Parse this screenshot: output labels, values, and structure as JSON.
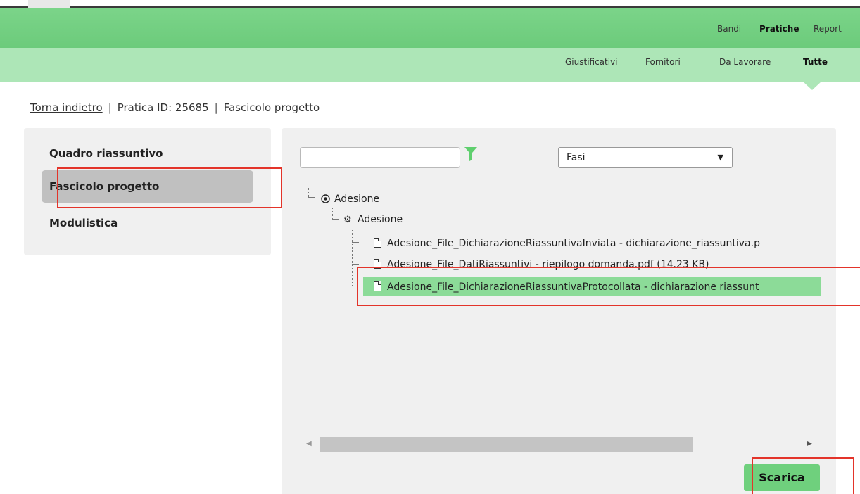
{
  "top_nav": {
    "items": [
      {
        "label": "Bandi",
        "active": false
      },
      {
        "label": "Pratiche",
        "active": true
      },
      {
        "label": "Report",
        "active": false
      }
    ]
  },
  "sub_nav": {
    "items": [
      {
        "label": "Giustificativi",
        "active": false
      },
      {
        "label": "Fornitori",
        "active": false
      },
      {
        "label": "Da Lavorare",
        "active": false
      },
      {
        "label": "Tutte",
        "active": true
      }
    ]
  },
  "breadcrumb": {
    "back_link": "Torna indietro",
    "separator": "|",
    "pratica_id": "Pratica ID: 25685",
    "current": "Fascicolo progetto"
  },
  "sidebar": {
    "items": [
      {
        "label": "Quadro riassuntivo",
        "active": false
      },
      {
        "label": "Fascicolo progetto",
        "active": true
      },
      {
        "label": "Modulistica",
        "active": false
      }
    ]
  },
  "main": {
    "search": {
      "value": "",
      "placeholder": ""
    },
    "filter_icon": "filter-icon",
    "select": {
      "value": "Fasi",
      "arrow": "▼"
    },
    "tree": {
      "root": {
        "label": "Adesione",
        "icon": "radio-target-icon"
      },
      "group": {
        "label": "Adesione",
        "icon": "gear-icon"
      },
      "files": [
        {
          "label": "Adesione_File_DichiarazioneRiassuntivaInviata - dichiarazione_riassuntiva.p",
          "selected": false
        },
        {
          "label": "Adesione_File_DatiRiassuntivi - riepilogo domanda.pdf (14.23 KB)",
          "selected": false
        },
        {
          "label": "Adesione_File_DichiarazioneRiassuntivaProtocollata - dichiarazione riassunt",
          "selected": true
        }
      ]
    },
    "scroll_left": "◀",
    "scroll_right": "▶",
    "download_button": "Scarica"
  },
  "colors": {
    "nav_green": "#6ccb7b",
    "subnav_green": "#ade6b7",
    "selected_row": "#8cdb98",
    "button_green": "#6fd07d",
    "highlight_red": "#e3342a"
  }
}
